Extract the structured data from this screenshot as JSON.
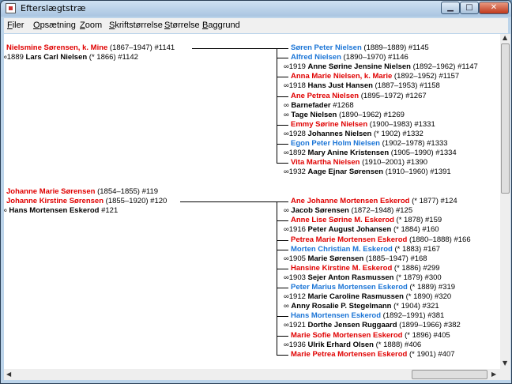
{
  "window": {
    "title": "Efterslægtstræ"
  },
  "menu": [
    {
      "label": "Filer",
      "ul": "F",
      "rest": "iler"
    },
    {
      "label": "Opsætning",
      "ul": "O",
      "rest": "psætning"
    },
    {
      "label": "Zoom",
      "ul": "Z",
      "rest": "oom"
    },
    {
      "label": "Skriftstørrelse",
      "ul": "S",
      "rest": "kriftstørrelse"
    },
    {
      "label": "Størrelse",
      "ul": "S",
      "rest": "tørrelse"
    },
    {
      "label": "Baggrund",
      "ul": "B",
      "rest": "aggrund"
    }
  ],
  "colors": {
    "female": "#e00000",
    "male": "#1a74d6",
    "text": "#000000"
  },
  "families": [
    {
      "parents_left": [
        {
          "name": "Nielsmine Sørensen, k. Mine",
          "info": "(1867–1947) #1141",
          "color": "red",
          "bold": true
        },
        {
          "prefix": "∞1889",
          "name": "Lars Carl Nielsen",
          "info": "(* 1866) #1142",
          "color": "black",
          "bold": true
        }
      ],
      "children": [
        {
          "name": "Søren Peter Nielsen",
          "info": "(1889–1889) #1145",
          "color": "blue",
          "child": true
        },
        {
          "name": "Alfred Nielsen",
          "info": "(1890–1970) #1146",
          "color": "blue",
          "child": true
        },
        {
          "prefix": "∞1919",
          "name": "Anne Sørine Jensine Nielsen",
          "info": "(1892–1962) #1147",
          "color": "black",
          "child": false
        },
        {
          "name": "Anna Marie Nielsen, k. Marie",
          "info": "(1892–1952) #1157",
          "color": "red",
          "child": true
        },
        {
          "prefix": "∞1918",
          "name": "Hans Just Hansen",
          "info": "(1887–1953) #1158",
          "color": "black",
          "child": false
        },
        {
          "name": "Ane Petrea Nielsen",
          "info": "(1895–1972) #1267",
          "color": "red",
          "child": true
        },
        {
          "prefix": "∞",
          "name": "Barnefader",
          "info": "#1268",
          "color": "black",
          "child": false
        },
        {
          "prefix": "∞",
          "name": "Tage Nielsen",
          "info": "(1890–1962) #1269",
          "color": "black",
          "child": false
        },
        {
          "name": "Emmy Sørine Nielsen",
          "info": "(1900–1983) #1331",
          "color": "red",
          "child": true
        },
        {
          "prefix": "∞1928",
          "name": "Johannes Nielsen",
          "info": "(* 1902) #1332",
          "color": "black",
          "child": false
        },
        {
          "name": "Egon Peter Holm Nielsen",
          "info": "(1902–1978) #1333",
          "color": "blue",
          "child": true
        },
        {
          "prefix": "∞1892",
          "name": "Mary Anine Kristensen",
          "info": "(1905–1990) #1334",
          "color": "black",
          "child": false
        },
        {
          "name": "Vita Martha Nielsen",
          "info": "(1910–2001) #1390",
          "color": "red",
          "child": true
        },
        {
          "prefix": "∞1932",
          "name": "Aage Ejnar Sørensen",
          "info": "(1910–1960) #1391",
          "color": "black",
          "child": false
        }
      ]
    },
    {
      "parents_left": [
        {
          "name": "Johanne Marie Sørensen",
          "info": "(1854–1855) #119",
          "color": "red",
          "bold": true
        },
        {
          "name": "Johanne Kirstine Sørensen",
          "info": "(1855–1920) #120",
          "color": "red",
          "bold": true
        },
        {
          "prefix": "∞",
          "name": "Hans Mortensen Eskerod",
          "info": "#121",
          "color": "black",
          "bold": true
        }
      ],
      "children": [
        {
          "name": "Ane Johanne Mortensen Eskerod",
          "info": "(* 1877) #124",
          "color": "red",
          "child": true
        },
        {
          "prefix": "∞",
          "name": "Jacob Sørensen",
          "info": "(1872–1948) #125",
          "color": "black",
          "child": false
        },
        {
          "name": "Anne Lise Sørine M. Eskerod",
          "info": "(* 1878) #159",
          "color": "red",
          "child": true
        },
        {
          "prefix": "∞1916",
          "name": "Peter August Johansen",
          "info": "(* 1884) #160",
          "color": "black",
          "child": false
        },
        {
          "name": "Petrea Marie Mortensen Eskerod",
          "info": "(1880–1888) #166",
          "color": "red",
          "child": true
        },
        {
          "name": "Morten Christian M. Eskerod",
          "info": "(* 1883) #167",
          "color": "blue",
          "child": true
        },
        {
          "prefix": "∞1905",
          "name": "Marie Sørensen",
          "info": "(1885–1947) #168",
          "color": "black",
          "child": false
        },
        {
          "name": "Hansine Kirstine M. Eskerod",
          "info": "(* 1886) #299",
          "color": "red",
          "child": true
        },
        {
          "prefix": "∞1903",
          "name": "Sejer Anton Rasmussen",
          "info": "(* 1879) #300",
          "color": "black",
          "child": false
        },
        {
          "name": "Peter Marius Mortensen Eskerod",
          "info": "(* 1889) #319",
          "color": "blue",
          "child": true
        },
        {
          "prefix": "∞1912",
          "name": "Marie Caroline Rasmussen",
          "info": "(* 1890) #320",
          "color": "black",
          "child": false
        },
        {
          "prefix": "∞",
          "name": "Anny Rosalie P. Stegelmann",
          "info": "(* 1904) #321",
          "color": "black",
          "child": false
        },
        {
          "name": "Hans Mortensen Eskerod",
          "info": "(1892–1991) #381",
          "color": "blue",
          "child": true
        },
        {
          "prefix": "∞1921",
          "name": "Dorthe Jensen Ruggaard",
          "info": "(1899–1966) #382",
          "color": "black",
          "child": false
        },
        {
          "name": "Marie Sofie Mortensen Eskerod",
          "info": "(* 1896) #405",
          "color": "red",
          "child": true
        },
        {
          "prefix": "∞1936",
          "name": "Ulrik Erhard Olsen",
          "info": "(* 1888) #406",
          "color": "black",
          "child": false
        },
        {
          "name": "Marie Petrea Mortensen Eskerod",
          "info": "(* 1901) #407",
          "color": "red",
          "child": true
        }
      ]
    }
  ]
}
